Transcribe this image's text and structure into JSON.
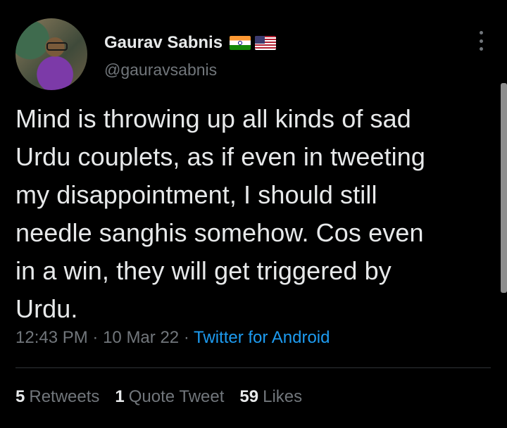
{
  "author": {
    "display_name": "Gaurav Sabnis",
    "handle": "@gauravsabnis",
    "flags": [
      "india-flag",
      "usa-flag"
    ]
  },
  "tweet": {
    "text": "Mind is throwing up all kinds of sad\nUrdu couplets, as if even in tweeting\nmy disappointment, I should still\nneedle sanghis somehow. Cos even\nin a win, they will get triggered by\nUrdu.",
    "time": "12:43 PM",
    "date": "10 Mar 22",
    "separator": "·",
    "source": "Twitter for Android"
  },
  "stats": {
    "retweets_count": "5",
    "retweets_label": "Retweets",
    "quote_count": "1",
    "quote_label": "Quote Tweet",
    "likes_count": "59",
    "likes_label": "Likes"
  },
  "colors": {
    "background": "#000000",
    "primary_text": "#e7e9ea",
    "secondary_text": "#71767b",
    "link": "#1d9bf0",
    "divider": "#2f3336"
  }
}
